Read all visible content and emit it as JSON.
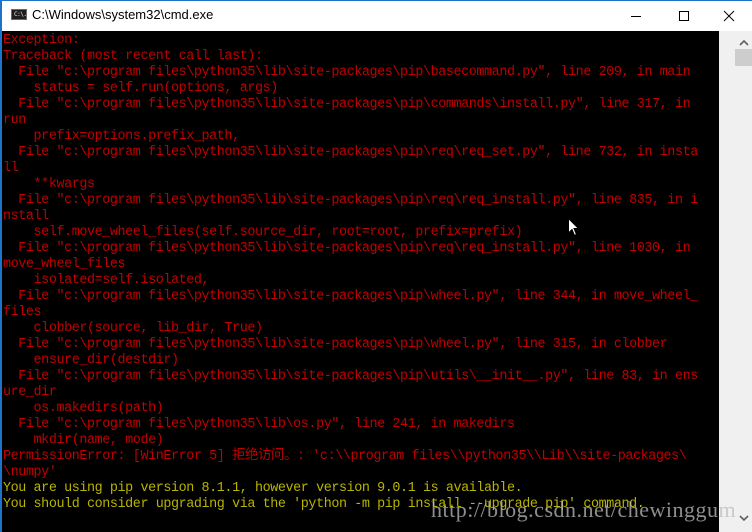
{
  "window": {
    "title": "C:\\Windows\\system32\\cmd.exe",
    "app_icon": "cmd-icon",
    "app_icon_text": "C:\\.",
    "controls": {
      "minimize": "minimize-icon",
      "maximize": "maximize-icon",
      "close": "close-icon"
    }
  },
  "console": {
    "colors": {
      "error": "#c10000",
      "warning": "#b9b400",
      "background": "#000000"
    },
    "lines": [
      {
        "text": "Exception:",
        "color": "red"
      },
      {
        "text": "Traceback (most recent call last):",
        "color": "red"
      },
      {
        "text": "  File \"c:\\program files\\python35\\lib\\site-packages\\pip\\basecommand.py\", line 209, in main",
        "color": "red"
      },
      {
        "text": "    status = self.run(options, args)",
        "color": "red"
      },
      {
        "text": "  File \"c:\\program files\\python35\\lib\\site-packages\\pip\\commands\\install.py\", line 317, in",
        "color": "red"
      },
      {
        "text": "run",
        "color": "red"
      },
      {
        "text": "    prefix=options.prefix_path,",
        "color": "red"
      },
      {
        "text": "  File \"c:\\program files\\python35\\lib\\site-packages\\pip\\req\\req_set.py\", line 732, in insta",
        "color": "red"
      },
      {
        "text": "ll",
        "color": "red"
      },
      {
        "text": "    **kwargs",
        "color": "red"
      },
      {
        "text": "  File \"c:\\program files\\python35\\lib\\site-packages\\pip\\req\\req_install.py\", line 835, in i",
        "color": "red"
      },
      {
        "text": "nstall",
        "color": "red"
      },
      {
        "text": "    self.move_wheel_files(self.source_dir, root=root, prefix=prefix)",
        "color": "red"
      },
      {
        "text": "  File \"c:\\program files\\python35\\lib\\site-packages\\pip\\req\\req_install.py\", line 1030, in",
        "color": "red"
      },
      {
        "text": "move_wheel_files",
        "color": "red"
      },
      {
        "text": "    isolated=self.isolated,",
        "color": "red"
      },
      {
        "text": "  File \"c:\\program files\\python35\\lib\\site-packages\\pip\\wheel.py\", line 344, in move_wheel_",
        "color": "red"
      },
      {
        "text": "files",
        "color": "red"
      },
      {
        "text": "    clobber(source, lib_dir, True)",
        "color": "red"
      },
      {
        "text": "  File \"c:\\program files\\python35\\lib\\site-packages\\pip\\wheel.py\", line 315, in clobber",
        "color": "red"
      },
      {
        "text": "    ensure_dir(destdir)",
        "color": "red"
      },
      {
        "text": "  File \"c:\\program files\\python35\\lib\\site-packages\\pip\\utils\\__init__.py\", line 83, in ens",
        "color": "red"
      },
      {
        "text": "ure_dir",
        "color": "red"
      },
      {
        "text": "    os.makedirs(path)",
        "color": "red"
      },
      {
        "text": "  File \"c:\\program files\\python35\\lib\\os.py\", line 241, in makedirs",
        "color": "red"
      },
      {
        "text": "    mkdir(name, mode)",
        "color": "red"
      },
      {
        "text": "PermissionError: [WinError 5] 拒绝访问。: 'c:\\\\program files\\\\python35\\\\Lib\\\\site-packages\\",
        "color": "red"
      },
      {
        "text": "\\numpy'",
        "color": "red"
      },
      {
        "text": "You are using pip version 8.1.1, however version 9.0.1 is available.",
        "color": "yellow"
      },
      {
        "text": "You should consider upgrading via the 'python -m pip install --upgrade pip' command.",
        "color": "yellow"
      }
    ]
  },
  "scrollbar": {
    "up": "chevron-up-icon",
    "down": "chevron-down-icon",
    "position": 0.0
  },
  "watermark": "http://blog.csdn.net/chewinggum"
}
